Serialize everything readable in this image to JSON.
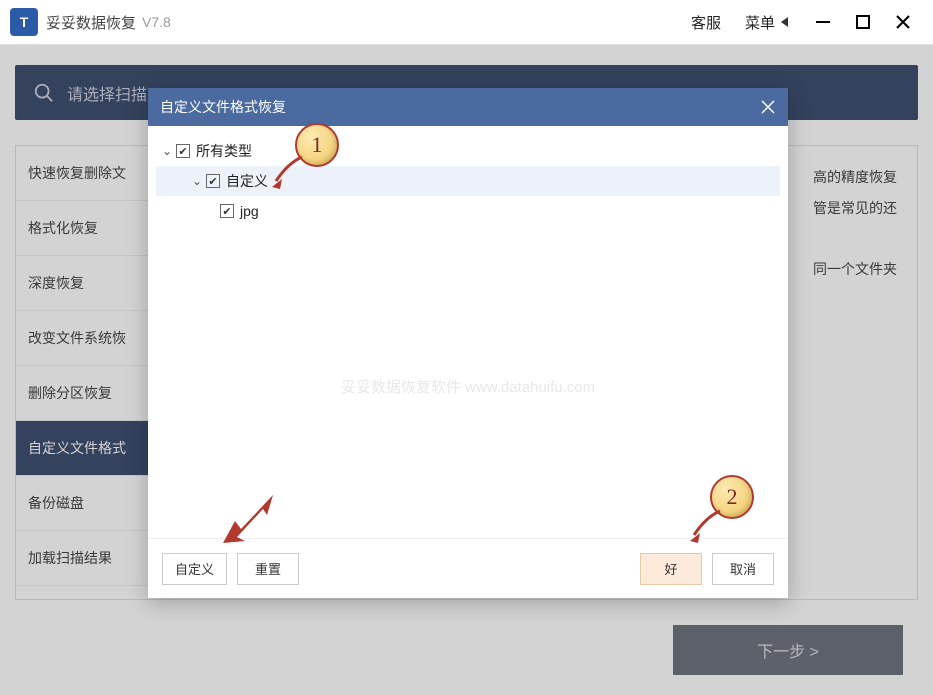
{
  "app": {
    "logo_text": "T",
    "title": "妥妥数据恢复",
    "version": "V7.8"
  },
  "titlebar": {
    "support": "客服",
    "menu": "菜单"
  },
  "search": {
    "placeholder": "请选择扫描"
  },
  "sidemenu": {
    "items": [
      "快速恢复删除文",
      "格式化恢复",
      "深度恢复",
      "改变文件系统恢",
      "删除分区恢复",
      "自定义文件格式",
      "备份磁盘",
      "加载扫描结果"
    ],
    "active_index": 5
  },
  "desc": {
    "line1_tail": "高的精度恢复",
    "line2_tail": "管是常见的还",
    "line3_tail": "同一个文件夹"
  },
  "next_button": "下一步 >",
  "modal": {
    "title": "自定义文件格式恢复",
    "tree": {
      "root": "所有类型",
      "child1": "自定义",
      "leaf1": "jpg"
    },
    "watermark": "妥妥数据恢复软件 www.datahuifu.com",
    "buttons": {
      "custom": "自定义",
      "reset": "重置",
      "ok": "好",
      "cancel": "取消"
    }
  },
  "callouts": {
    "c1": "1",
    "c2": "2"
  }
}
